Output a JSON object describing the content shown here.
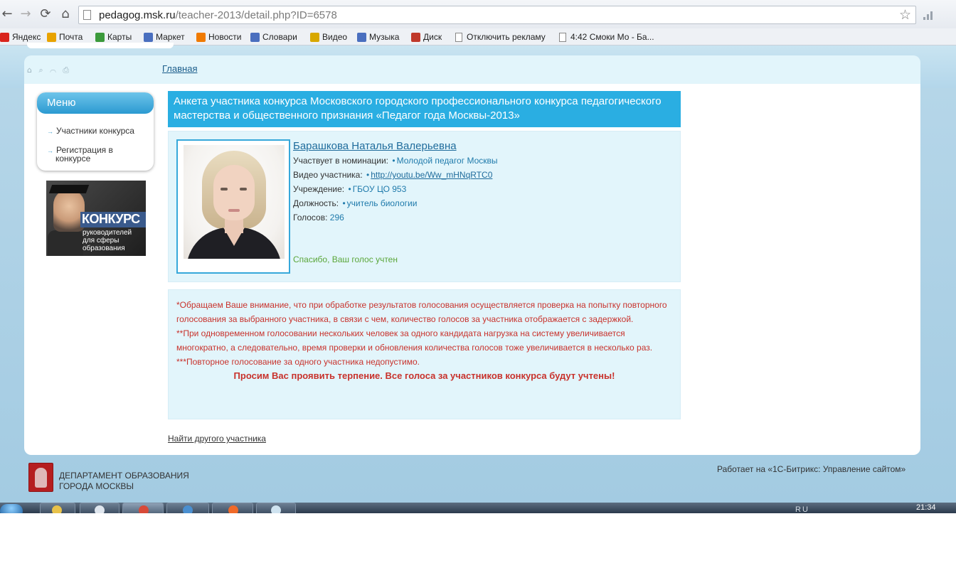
{
  "browser": {
    "url_domain": "pedagog.msk.ru",
    "url_path": "/teacher-2013/detail.php?ID=6578",
    "back_icon": "←",
    "forward_icon": "→",
    "reload_icon": "⟳",
    "home_icon": "⌂",
    "star_icon": "☆"
  },
  "bookmarks": [
    {
      "label": "Яндекс",
      "icon": "yandex-icon",
      "color": "#d9251d"
    },
    {
      "label": "Почта",
      "icon": "mail-icon",
      "color": "#e8a300"
    },
    {
      "label": "Карты",
      "icon": "maps-icon",
      "color": "#3b9a3b"
    },
    {
      "label": "Маркет",
      "icon": "market-icon",
      "color": "#4a6fbf"
    },
    {
      "label": "Новости",
      "icon": "news-icon",
      "color": "#f07a00"
    },
    {
      "label": "Словари",
      "icon": "dict-icon",
      "color": "#4a6fbf"
    },
    {
      "label": "Видео",
      "icon": "video-icon",
      "color": "#d8a800"
    },
    {
      "label": "Музыка",
      "icon": "music-icon",
      "color": "#4a6fbf"
    },
    {
      "label": "Диск",
      "icon": "disk-icon",
      "color": "#c0392b"
    },
    {
      "label": "Отключить рекламу",
      "icon": "page-icon",
      "color": "#ffffff"
    },
    {
      "label": "4:42 Смоки Мо - Ба...",
      "icon": "page-icon",
      "color": "#ffffff"
    }
  ],
  "header": {
    "utility_icons": "⌂ ⌕ ⌒ ⎙",
    "breadcrumb": "Главная"
  },
  "menu": {
    "title": "Меню",
    "arrow": "→",
    "items": [
      {
        "label": "Участники конкурса"
      },
      {
        "label": "Регистрация в конкурсе"
      }
    ]
  },
  "banner": {
    "title": "КОНКУРС",
    "subtitle": "руководителей для сферы образования"
  },
  "main": {
    "title": "Анкета участника конкурса Московского городского профессионального конкурса педагогического мастерства и общественного признания «Педагог года Москвы-2013»",
    "participant": {
      "name": "Барашкова Наталья Валерьевна",
      "nomination_label": "Участвует в номинации:",
      "nomination_value": "Молодой педагог Москвы",
      "video_label": "Видео участника:",
      "video_value": "http://youtu.be/Ww_mHNqRTC0",
      "institution_label": "Учреждение:",
      "institution_value": "ГБОУ ЦО 953",
      "position_label": "Должность:",
      "position_value": "учитель биологии",
      "votes_label": "Голосов:",
      "votes_value": "296",
      "thanks": "Спасибо, Ваш голос учтен"
    },
    "notice": {
      "line1": "*Обращаем Ваше внимание, что при обработке результатов голосования осуществляется проверка на попытку повторного голосования за выбранного участника, в связи с чем, количество голосов за участника отображается с задержкой.",
      "line2": "**При одновременном голосовании нескольких человек за одного кандидата нагрузка на систему увеличивается многократно, а следовательно, время проверки и обновления количества голосов тоже увеличивается в несколько раз.",
      "line3": "***Повторное голосование за одного участника недопустимо.",
      "emphasis": "Просим Вас проявить терпение. Все голоса за участников конкурса будут учтены!"
    },
    "find_link": "Найти другого участника"
  },
  "footer": {
    "dept_line1": "ДЕПАРТАМЕНТ ОБРАЗОВАНИЯ",
    "dept_line2": "ГОРОДА МОСКВЫ",
    "powered": "Работает на «1С-Битрикс: Управление сайтом»"
  },
  "taskbar": {
    "clock": "21:34",
    "tray": "RU"
  },
  "colors": {
    "accent": "#2aaee2",
    "notice_red": "#c8322c",
    "link_blue": "#1f6c9c",
    "thanks_green": "#5aa639"
  }
}
